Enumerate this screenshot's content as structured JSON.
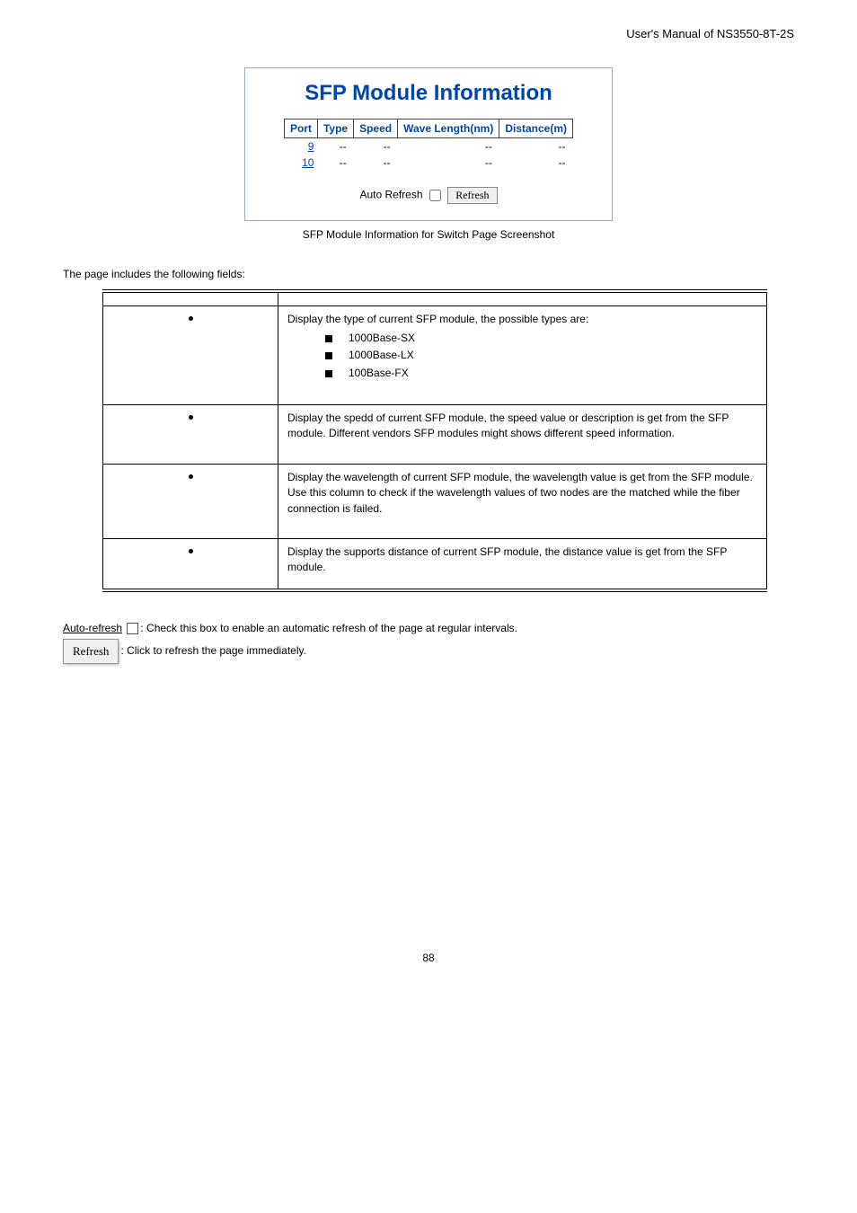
{
  "header": "User's Manual of NS3550-8T-2S",
  "sfp_box": {
    "title": "SFP Module Information",
    "columns": [
      "Port",
      "Type",
      "Speed",
      "Wave Length(nm)",
      "Distance(m)"
    ],
    "rows": [
      {
        "port": "9",
        "type": "--",
        "speed": "--",
        "wave": "--",
        "dist": "--"
      },
      {
        "port": "10",
        "type": "--",
        "speed": "--",
        "wave": "--",
        "dist": "--"
      }
    ],
    "auto_refresh_label": "Auto Refresh",
    "refresh_btn": "Refresh"
  },
  "screenshot_caption": "SFP Module Information for Switch Page Screenshot",
  "intro": "The page includes the following fields:",
  "table": [
    {
      "desc_intro": "Display the type of current SFP module, the possible types are:",
      "items": [
        "1000Base-SX",
        "1000Base-LX",
        "100Base-FX"
      ]
    },
    {
      "desc": "Display the spedd of current SFP module, the speed value or description is get from the SFP module. Different vendors SFP modules might shows different speed information."
    },
    {
      "desc": "Display the wavelength of current SFP module, the wavelength value is get from the SFP module. Use this column to check if the wavelength values of two nodes are the matched while the fiber connection is failed."
    },
    {
      "desc": "Display the supports distance of current SFP module, the distance value is get from the SFP module."
    }
  ],
  "footer": {
    "auto_refresh_label": "Auto-refresh",
    "auto_refresh_text": ": Check this box to enable an automatic refresh of the page at regular intervals.",
    "refresh_btn_label": "Refresh",
    "refresh_text": ": Click to refresh the page immediately."
  },
  "page_number": "88"
}
